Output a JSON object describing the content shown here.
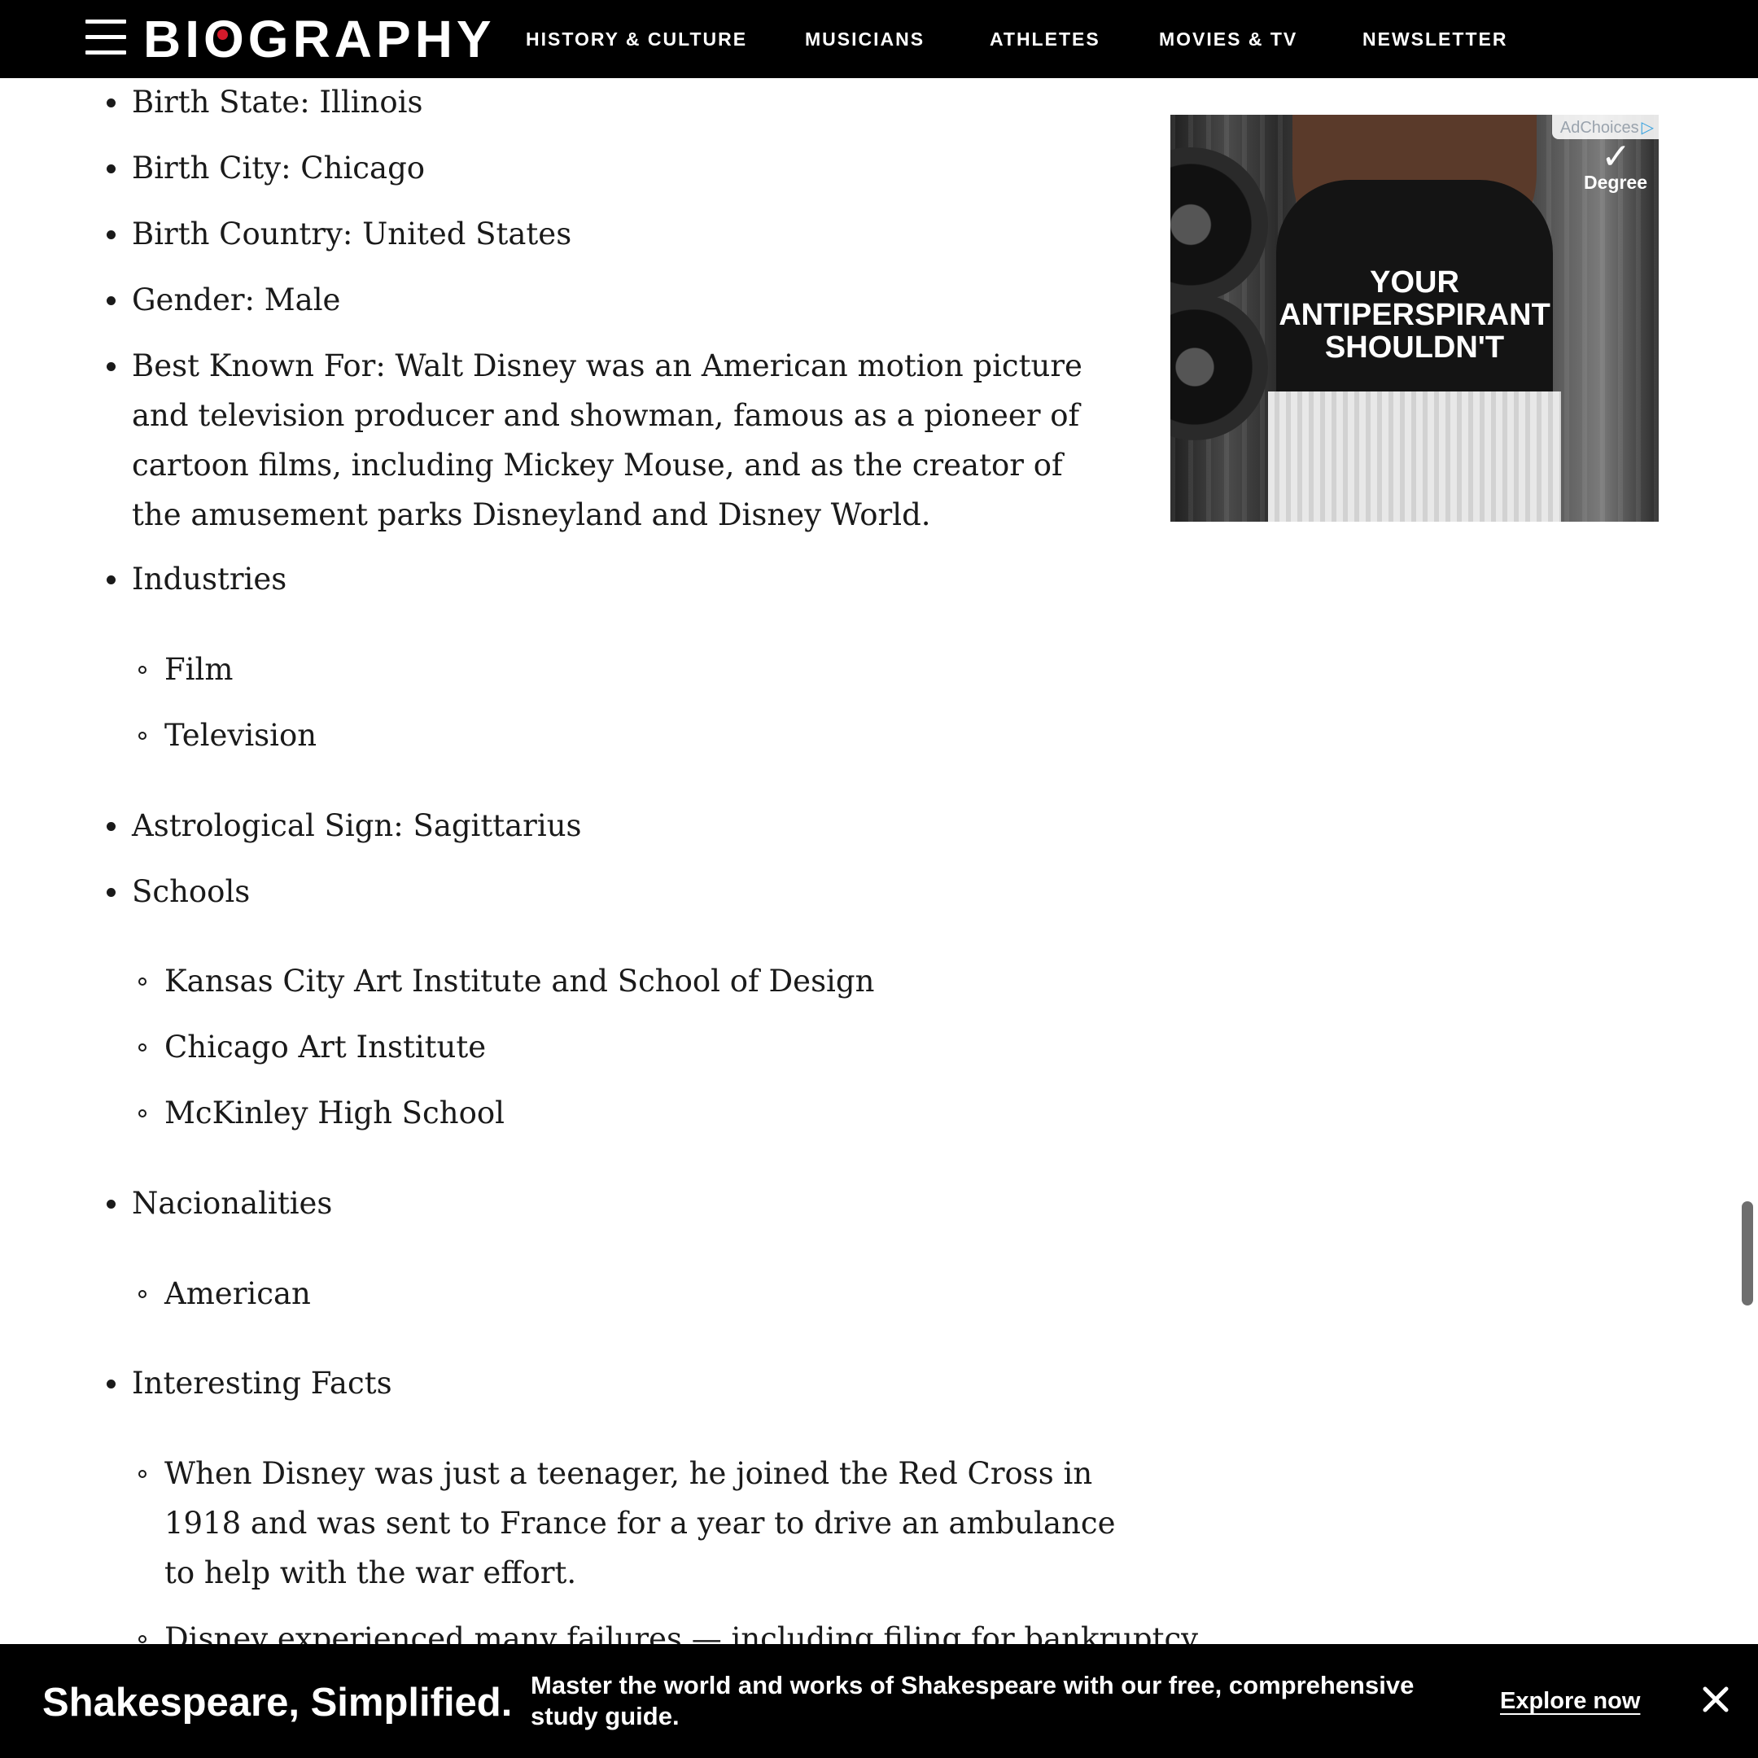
{
  "header": {
    "logo": "BIOGRAPHY",
    "nav": [
      "HISTORY & CULTURE",
      "MUSICIANS",
      "ATHLETES",
      "MOVIES & TV",
      "NEWSLETTER"
    ]
  },
  "facts": {
    "birth_state": "Birth State: Illinois",
    "birth_city": "Birth City: Chicago",
    "birth_country": "Birth Country: United States",
    "gender": "Gender: Male",
    "best_known_for": "Best Known For: Walt Disney was an American motion picture and television producer and showman, famous as a pioneer of cartoon films, including Mickey Mouse, and as the creator of the amusement parks Disneyland and Disney World.",
    "industries_label": "Industries",
    "industries": [
      "Film",
      "Television"
    ],
    "astrological_sign": "Astrological Sign: Sagittarius",
    "schools_label": "Schools",
    "schools": [
      "Kansas City Art Institute and School of Design",
      "Chicago Art Institute",
      "McKinley High School"
    ],
    "nationalities_label": "Nacionalities",
    "nationalities": [
      "American"
    ],
    "interesting_facts_label": "Interesting Facts",
    "interesting_facts": [
      "When Disney was just a teenager, he joined the Red Cross in 1918 and was sent to France for a year to drive an ambulance to help with the war effort.",
      "Disney experienced many failures — including filing for bankruptcy"
    ]
  },
  "ad": {
    "adchoices_label": "AdChoices",
    "brand": "Degree",
    "headline": "YOUR ANTIPERSPIRANT SHOULDN'T"
  },
  "banner": {
    "title": "Shakespeare, Simplified.",
    "text": "Master the world and works of Shakespeare with our free, comprehensive study guide.",
    "cta": "Explore now"
  },
  "colors": {
    "nav_background": "#000000",
    "logo_dot": "#d31a2b",
    "text": "#1a1a1a"
  }
}
